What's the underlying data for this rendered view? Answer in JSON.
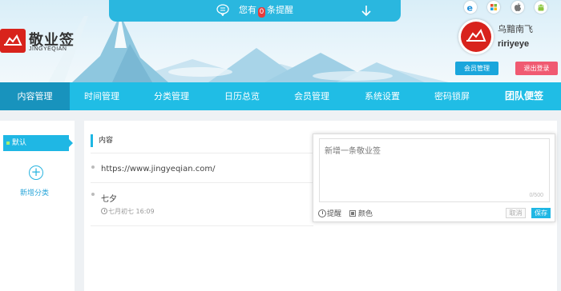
{
  "header": {
    "notice": {
      "prefix": "您有",
      "count": "0",
      "suffix": "条提醒"
    },
    "logo": {
      "cn": "敬业签",
      "en": "JINGYEQIAN"
    },
    "platforms": [
      "ie-icon",
      "windows-icon",
      "apple-icon",
      "android-icon"
    ],
    "user": {
      "nickname": "乌黯南飞",
      "username": "ririyeye"
    },
    "member_btn": "会员管理",
    "logout_btn": "退出登录"
  },
  "nav": {
    "items": [
      "内容管理",
      "时间管理",
      "分类管理",
      "日历总览",
      "会员管理",
      "系统设置",
      "密码锁屏",
      "团队便签"
    ],
    "active": "内容管理"
  },
  "sidebar": {
    "default_category": "默认",
    "add_category": "新增分类"
  },
  "main": {
    "section_title": "内容",
    "notes": [
      {
        "title": "https://www.jingyeqian.com/"
      },
      {
        "title": "七夕",
        "time": "七月初七 16:09"
      }
    ]
  },
  "composer": {
    "placeholder": "新增一条敬业签",
    "counter": "0/500",
    "remind_label": "提醒",
    "color_label": "颜色",
    "cancel_label": "取消",
    "save_label": "保存"
  },
  "colors": {
    "accent": "#20bde5",
    "nav_active": "#1893bd",
    "logo_red": "#d8231c",
    "logout_pink": "#f05a71",
    "member_blue": "#1aa6dc"
  }
}
